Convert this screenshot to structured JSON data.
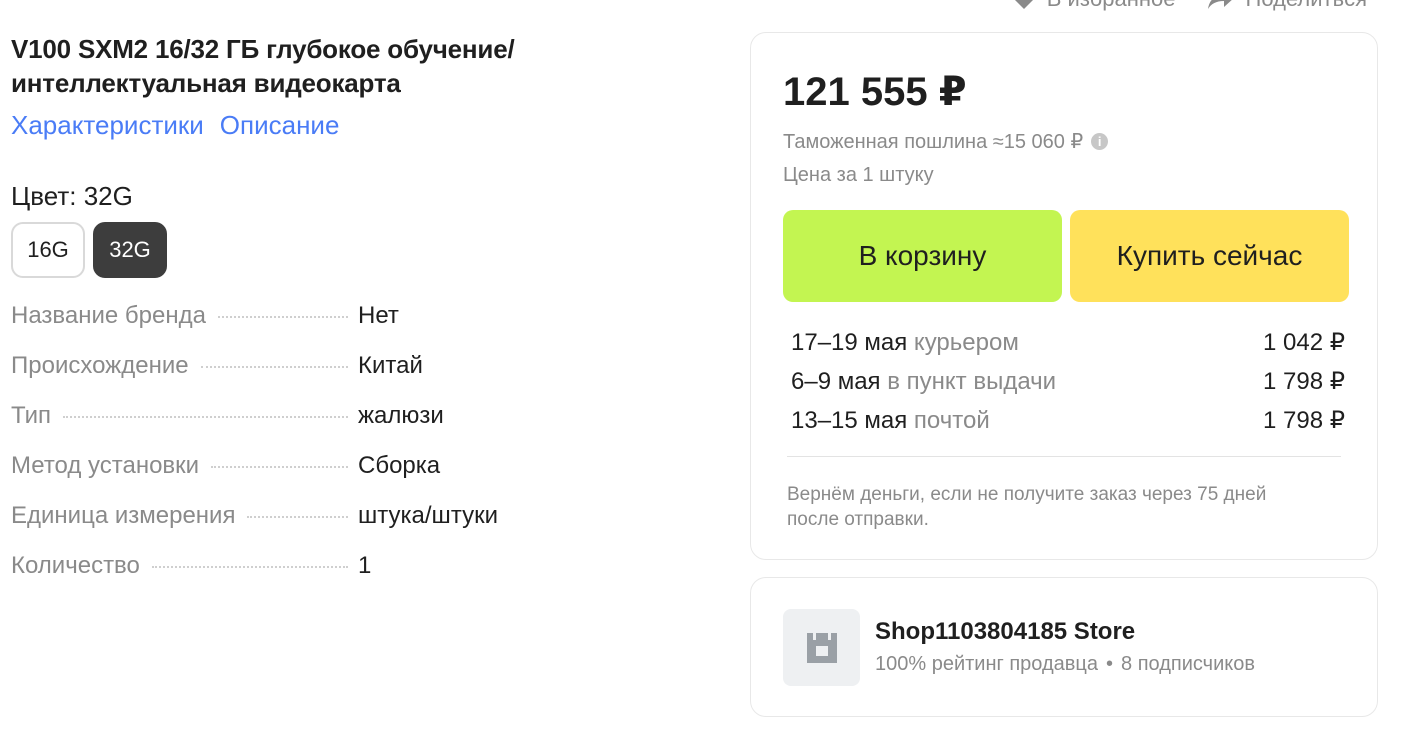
{
  "top_actions": {
    "favorite_label": "В избранное",
    "share_label": "Поделиться"
  },
  "product": {
    "title": "V100 SXM2 16/32 ГБ глубокое обучение/ интеллектуальная видеокарта",
    "links": {
      "characteristics": "Характеристики",
      "description": "Описание"
    },
    "color_label": "Цвет: 32G",
    "variants": [
      {
        "label": "16G",
        "selected": false
      },
      {
        "label": "32G",
        "selected": true
      }
    ],
    "specs": [
      {
        "key": "Название бренда",
        "value": "Нет"
      },
      {
        "key": "Происхождение",
        "value": "Китай"
      },
      {
        "key": "Тип",
        "value": "жалюзи"
      },
      {
        "key": "Метод установки",
        "value": "Сборка"
      },
      {
        "key": "Единица измерения",
        "value": "штука/штуки"
      },
      {
        "key": "Количество",
        "value": "1"
      }
    ]
  },
  "purchase": {
    "price": "121 555 ₽",
    "duty": "Таможенная пошлина ≈15 060 ₽",
    "per_unit": "Цена за 1 штуку",
    "add_to_cart": "В корзину",
    "buy_now": "Купить сейчас",
    "delivery": [
      {
        "date": "17–19 мая",
        "method": "курьером",
        "price": "1 042 ₽"
      },
      {
        "date": "6–9 мая",
        "method": "в пункт выдачи",
        "price": "1 798 ₽"
      },
      {
        "date": "13–15 мая",
        "method": "почтой",
        "price": "1 798 ₽"
      }
    ],
    "refund_note": "Вернём деньги, если не получите заказ через 75 дней после отправки."
  },
  "seller": {
    "name": "Shop1103804185 Store",
    "rating": "100% рейтинг продавца",
    "subscribers": "8 подписчиков"
  },
  "colors": {
    "link": "#4a7cf6",
    "cart_button": "#c3f551",
    "buy_button": "#ffe15b",
    "selected_variant": "#3d3d3d"
  }
}
